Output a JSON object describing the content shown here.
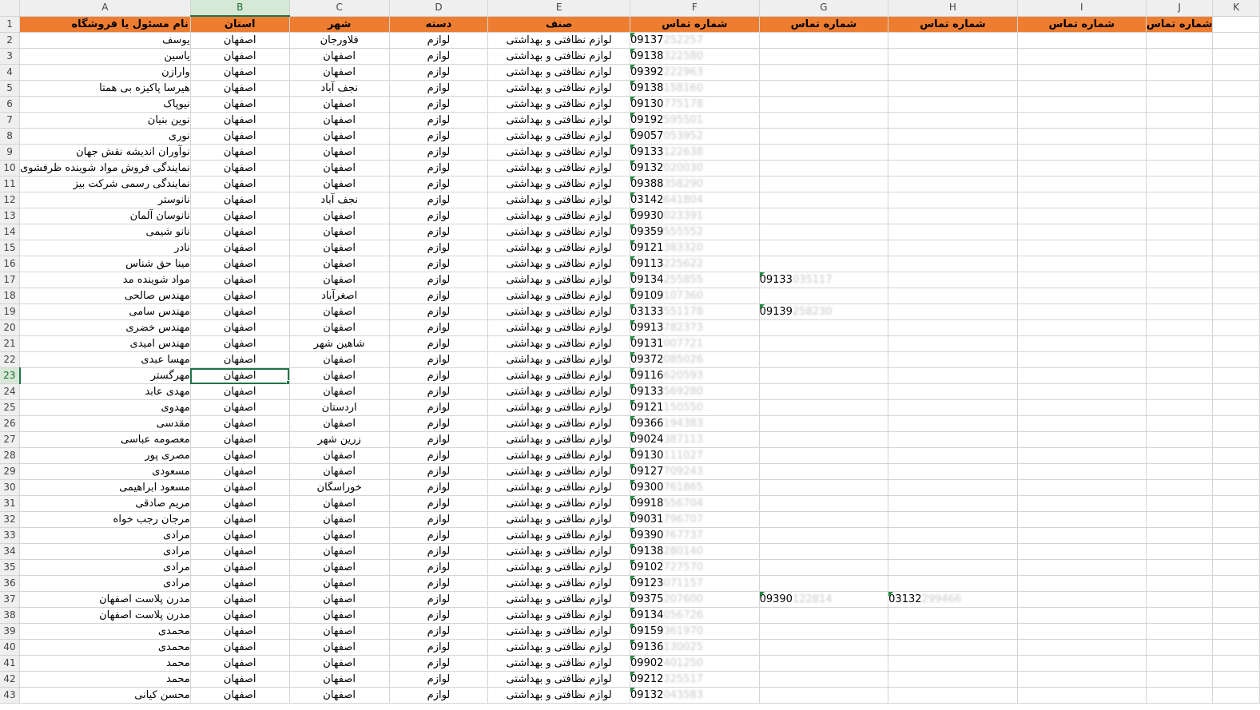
{
  "columns": [
    "A",
    "B",
    "C",
    "D",
    "E",
    "F",
    "G",
    "H",
    "I",
    "J",
    "K"
  ],
  "selected_column": "B",
  "selected_row": 23,
  "header": {
    "row_number": "1",
    "name": "نام مسئول یا فروشگاه",
    "province": "استان",
    "city": "شهر",
    "category": "دسته",
    "trade": "صنف",
    "phone1": "شماره تماس",
    "phone2": "شماره تماس",
    "phone3": "شماره تماس",
    "phone4": "شماره تماس",
    "phone5": "شماره تماس"
  },
  "rows": [
    {
      "n": "2",
      "name": "یوسف",
      "province": "اصفهان",
      "city": "فلاورجان",
      "category": "لوازم",
      "trade": "لوازم نظافتی و بهداشتی",
      "p1": "09137",
      "p1h": "252257",
      "p2": "",
      "p2h": "",
      "p3": "",
      "p3h": ""
    },
    {
      "n": "3",
      "name": "یاسین",
      "province": "اصفهان",
      "city": "اصفهان",
      "category": "لوازم",
      "trade": "لوازم نظافتی و بهداشتی",
      "p1": "09138",
      "p1h": "322580",
      "p2": "",
      "p2h": "",
      "p3": "",
      "p3h": ""
    },
    {
      "n": "4",
      "name": "وارازن",
      "province": "اصفهان",
      "city": "اصفهان",
      "category": "لوازم",
      "trade": "لوازم نظافتی و بهداشتی",
      "p1": "09392",
      "p1h": "222963",
      "p2": "",
      "p2h": "",
      "p3": "",
      "p3h": ""
    },
    {
      "n": "5",
      "name": "هیرسا پاکیزه بی همتا",
      "province": "اصفهان",
      "city": "نجف آباد",
      "category": "لوازم",
      "trade": "لوازم نظافتی و بهداشتی",
      "p1": "09138",
      "p1h": "158160",
      "p2": "",
      "p2h": "",
      "p3": "",
      "p3h": ""
    },
    {
      "n": "6",
      "name": "نیوپاک",
      "province": "اصفهان",
      "city": "اصفهان",
      "category": "لوازم",
      "trade": "لوازم نظافتی و بهداشتی",
      "p1": "09130",
      "p1h": "775178",
      "p2": "",
      "p2h": "",
      "p3": "",
      "p3h": ""
    },
    {
      "n": "7",
      "name": "نوین بنیان",
      "province": "اصفهان",
      "city": "اصفهان",
      "category": "لوازم",
      "trade": "لوازم نظافتی و بهداشتی",
      "p1": "09192",
      "p1h": "595501",
      "p2": "",
      "p2h": "",
      "p3": "",
      "p3h": ""
    },
    {
      "n": "8",
      "name": "نوری",
      "province": "اصفهان",
      "city": "اصفهان",
      "category": "لوازم",
      "trade": "لوازم نظافتی و بهداشتی",
      "p1": "09057",
      "p1h": "053952",
      "p2": "",
      "p2h": "",
      "p3": "",
      "p3h": ""
    },
    {
      "n": "9",
      "name": "نوآوران اندیشه نقش جهان",
      "province": "اصفهان",
      "city": "اصفهان",
      "category": "لوازم",
      "trade": "لوازم نظافتی و بهداشتی",
      "p1": "09133",
      "p1h": "122638",
      "p2": "",
      "p2h": "",
      "p3": "",
      "p3h": ""
    },
    {
      "n": "10",
      "name": "نمایندگی فروش مواد شوینده ظرفشوی",
      "province": "اصفهان",
      "city": "اصفهان",
      "category": "لوازم",
      "trade": "لوازم نظافتی و بهداشتی",
      "p1": "09132",
      "p1h": "020030",
      "p2": "",
      "p2h": "",
      "p3": "",
      "p3h": ""
    },
    {
      "n": "11",
      "name": "نمایندگی رسمی شرکت بیز",
      "province": "اصفهان",
      "city": "اصفهان",
      "category": "لوازم",
      "trade": "لوازم نظافتی و بهداشتی",
      "p1": "09388",
      "p1h": "358290",
      "p2": "",
      "p2h": "",
      "p3": "",
      "p3h": ""
    },
    {
      "n": "12",
      "name": "نانوستر",
      "province": "اصفهان",
      "city": "نجف آباد",
      "category": "لوازم",
      "trade": "لوازم نظافتی و بهداشتی",
      "p1": "03142",
      "p1h": "641804",
      "p2": "",
      "p2h": "",
      "p3": "",
      "p3h": ""
    },
    {
      "n": "13",
      "name": "نانوسان آلمان",
      "province": "اصفهان",
      "city": "اصفهان",
      "category": "لوازم",
      "trade": "لوازم نظافتی و بهداشتی",
      "p1": "09930",
      "p1h": "023391",
      "p2": "",
      "p2h": "",
      "p3": "",
      "p3h": ""
    },
    {
      "n": "14",
      "name": "نانو شیمی",
      "province": "اصفهان",
      "city": "اصفهان",
      "category": "لوازم",
      "trade": "لوازم نظافتی و بهداشتی",
      "p1": "09359",
      "p1h": "555552",
      "p2": "",
      "p2h": "",
      "p3": "",
      "p3h": ""
    },
    {
      "n": "15",
      "name": "نادر",
      "province": "اصفهان",
      "city": "اصفهان",
      "category": "لوازم",
      "trade": "لوازم نظافتی و بهداشتی",
      "p1": "09121",
      "p1h": "383320",
      "p2": "",
      "p2h": "",
      "p3": "",
      "p3h": ""
    },
    {
      "n": "16",
      "name": "مینا حق شناس",
      "province": "اصفهان",
      "city": "اصفهان",
      "category": "لوازم",
      "trade": "لوازم نظافتی و بهداشتی",
      "p1": "09113",
      "p1h": "225622",
      "p2": "",
      "p2h": "",
      "p3": "",
      "p3h": ""
    },
    {
      "n": "17",
      "name": "مواد شوینده مد",
      "province": "اصفهان",
      "city": "اصفهان",
      "category": "لوازم",
      "trade": "لوازم نظافتی و بهداشتی",
      "p1": "09134",
      "p1h": "255855",
      "p2": "09133",
      "p2h": "035117",
      "p3": "",
      "p3h": ""
    },
    {
      "n": "18",
      "name": "مهندس صالحی",
      "province": "اصفهان",
      "city": "اصغرآباد",
      "category": "لوازم",
      "trade": "لوازم نظافتی و بهداشتی",
      "p1": "09109",
      "p1h": "107360",
      "p2": "",
      "p2h": "",
      "p3": "",
      "p3h": ""
    },
    {
      "n": "19",
      "name": "مهندس سامی",
      "province": "اصفهان",
      "city": "اصفهان",
      "category": "لوازم",
      "trade": "لوازم نظافتی و بهداشتی",
      "p1": "03133",
      "p1h": "551178",
      "p2": "09139",
      "p2h": "258230",
      "p3": "",
      "p3h": ""
    },
    {
      "n": "20",
      "name": "مهندس خضری",
      "province": "اصفهان",
      "city": "اصفهان",
      "category": "لوازم",
      "trade": "لوازم نظافتی و بهداشتی",
      "p1": "09913",
      "p1h": "782373",
      "p2": "",
      "p2h": "",
      "p3": "",
      "p3h": ""
    },
    {
      "n": "21",
      "name": "مهندس امیدی",
      "province": "اصفهان",
      "city": "شاهین شهر",
      "category": "لوازم",
      "trade": "لوازم نظافتی و بهداشتی",
      "p1": "09131",
      "p1h": "007721",
      "p2": "",
      "p2h": "",
      "p3": "",
      "p3h": ""
    },
    {
      "n": "22",
      "name": "مهسا عبدی",
      "province": "اصفهان",
      "city": "اصفهان",
      "category": "لوازم",
      "trade": "لوازم نظافتی و بهداشتی",
      "p1": "09372",
      "p1h": "085026",
      "p2": "",
      "p2h": "",
      "p3": "",
      "p3h": ""
    },
    {
      "n": "23",
      "name": "مهرگستر",
      "province": "اصفهان",
      "city": "اصفهان",
      "category": "لوازم",
      "trade": "لوازم نظافتی و بهداشتی",
      "p1": "09116",
      "p1h": "620593",
      "p2": "",
      "p2h": "",
      "p3": "",
      "p3h": ""
    },
    {
      "n": "24",
      "name": "مهدی عابد",
      "province": "اصفهان",
      "city": "اصفهان",
      "category": "لوازم",
      "trade": "لوازم نظافتی و بهداشتی",
      "p1": "09133",
      "p1h": "569280",
      "p2": "",
      "p2h": "",
      "p3": "",
      "p3h": ""
    },
    {
      "n": "25",
      "name": "مهدوی",
      "province": "اصفهان",
      "city": "اردستان",
      "category": "لوازم",
      "trade": "لوازم نظافتی و بهداشتی",
      "p1": "09121",
      "p1h": "150550",
      "p2": "",
      "p2h": "",
      "p3": "",
      "p3h": ""
    },
    {
      "n": "26",
      "name": "مقدسی",
      "province": "اصفهان",
      "city": "اصفهان",
      "category": "لوازم",
      "trade": "لوازم نظافتی و بهداشتی",
      "p1": "09366",
      "p1h": "194383",
      "p2": "",
      "p2h": "",
      "p3": "",
      "p3h": ""
    },
    {
      "n": "27",
      "name": "معصومه عباسی",
      "province": "اصفهان",
      "city": "زرین شهر",
      "category": "لوازم",
      "trade": "لوازم نظافتی و بهداشتی",
      "p1": "09024",
      "p1h": "387113",
      "p2": "",
      "p2h": "",
      "p3": "",
      "p3h": ""
    },
    {
      "n": "28",
      "name": "مصری پور",
      "province": "اصفهان",
      "city": "اصفهان",
      "category": "لوازم",
      "trade": "لوازم نظافتی و بهداشتی",
      "p1": "09130",
      "p1h": "111027",
      "p2": "",
      "p2h": "",
      "p3": "",
      "p3h": ""
    },
    {
      "n": "29",
      "name": "مسعودی",
      "province": "اصفهان",
      "city": "اصفهان",
      "category": "لوازم",
      "trade": "لوازم نظافتی و بهداشتی",
      "p1": "09127",
      "p1h": "709243",
      "p2": "",
      "p2h": "",
      "p3": "",
      "p3h": ""
    },
    {
      "n": "30",
      "name": "مسعود ابراهیمی",
      "province": "اصفهان",
      "city": "خوراسگان",
      "category": "لوازم",
      "trade": "لوازم نظافتی و بهداشتی",
      "p1": "09300",
      "p1h": "761865",
      "p2": "",
      "p2h": "",
      "p3": "",
      "p3h": ""
    },
    {
      "n": "31",
      "name": "مریم صادقی",
      "province": "اصفهان",
      "city": "اصفهان",
      "category": "لوازم",
      "trade": "لوازم نظافتی و بهداشتی",
      "p1": "09918",
      "p1h": "556704",
      "p2": "",
      "p2h": "",
      "p3": "",
      "p3h": ""
    },
    {
      "n": "32",
      "name": "مرجان رجب خواه",
      "province": "اصفهان",
      "city": "اصفهان",
      "category": "لوازم",
      "trade": "لوازم نظافتی و بهداشتی",
      "p1": "09031",
      "p1h": "796707",
      "p2": "",
      "p2h": "",
      "p3": "",
      "p3h": ""
    },
    {
      "n": "33",
      "name": "مرادی",
      "province": "اصفهان",
      "city": "اصفهان",
      "category": "لوازم",
      "trade": "لوازم نظافتی و بهداشتی",
      "p1": "09390",
      "p1h": "767737",
      "p2": "",
      "p2h": "",
      "p3": "",
      "p3h": ""
    },
    {
      "n": "34",
      "name": "مرادی",
      "province": "اصفهان",
      "city": "اصفهان",
      "category": "لوازم",
      "trade": "لوازم نظافتی و بهداشتی",
      "p1": "09138",
      "p1h": "280140",
      "p2": "",
      "p2h": "",
      "p3": "",
      "p3h": ""
    },
    {
      "n": "35",
      "name": "مرادی",
      "province": "اصفهان",
      "city": "اصفهان",
      "category": "لوازم",
      "trade": "لوازم نظافتی و بهداشتی",
      "p1": "09102",
      "p1h": "727570",
      "p2": "",
      "p2h": "",
      "p3": "",
      "p3h": ""
    },
    {
      "n": "36",
      "name": "مرادی",
      "province": "اصفهان",
      "city": "اصفهان",
      "category": "لوازم",
      "trade": "لوازم نظافتی و بهداشتی",
      "p1": "09123",
      "p1h": "071157",
      "p2": "",
      "p2h": "",
      "p3": "",
      "p3h": ""
    },
    {
      "n": "37",
      "name": "مدرن پلاست اصفهان",
      "province": "اصفهان",
      "city": "اصفهان",
      "category": "لوازم",
      "trade": "لوازم نظافتی و بهداشتی",
      "p1": "09375",
      "p1h": "207600",
      "p2": "09390",
      "p2h": "122814",
      "p3": "03132",
      "p3h": "299466"
    },
    {
      "n": "38",
      "name": "مدرن پلاست اصفهان",
      "province": "اصفهان",
      "city": "اصفهان",
      "category": "لوازم",
      "trade": "لوازم نظافتی و بهداشتی",
      "p1": "09134",
      "p1h": "056726",
      "p2": "",
      "p2h": "",
      "p3": "",
      "p3h": ""
    },
    {
      "n": "39",
      "name": "محمدی",
      "province": "اصفهان",
      "city": "اصفهان",
      "category": "لوازم",
      "trade": "لوازم نظافتی و بهداشتی",
      "p1": "09159",
      "p1h": "361970",
      "p2": "",
      "p2h": "",
      "p3": "",
      "p3h": ""
    },
    {
      "n": "40",
      "name": "محمدی",
      "province": "اصفهان",
      "city": "اصفهان",
      "category": "لوازم",
      "trade": "لوازم نظافتی و بهداشتی",
      "p1": "09136",
      "p1h": "130025",
      "p2": "",
      "p2h": "",
      "p3": "",
      "p3h": ""
    },
    {
      "n": "41",
      "name": "محمد",
      "province": "اصفهان",
      "city": "اصفهان",
      "category": "لوازم",
      "trade": "لوازم نظافتی و بهداشتی",
      "p1": "09902",
      "p1h": "401250",
      "p2": "",
      "p2h": "",
      "p3": "",
      "p3h": ""
    },
    {
      "n": "42",
      "name": "محمد",
      "province": "اصفهان",
      "city": "اصفهان",
      "category": "لوازم",
      "trade": "لوازم نظافتی و بهداشتی",
      "p1": "09212",
      "p1h": "325517",
      "p2": "",
      "p2h": "",
      "p3": "",
      "p3h": ""
    },
    {
      "n": "43",
      "name": "محسن کیانی",
      "province": "اصفهان",
      "city": "اصفهان",
      "category": "لوازم",
      "trade": "لوازم نظافتی و بهداشتی",
      "p1": "09132",
      "p1h": "043583",
      "p2": "",
      "p2h": "",
      "p3": "",
      "p3h": ""
    }
  ]
}
